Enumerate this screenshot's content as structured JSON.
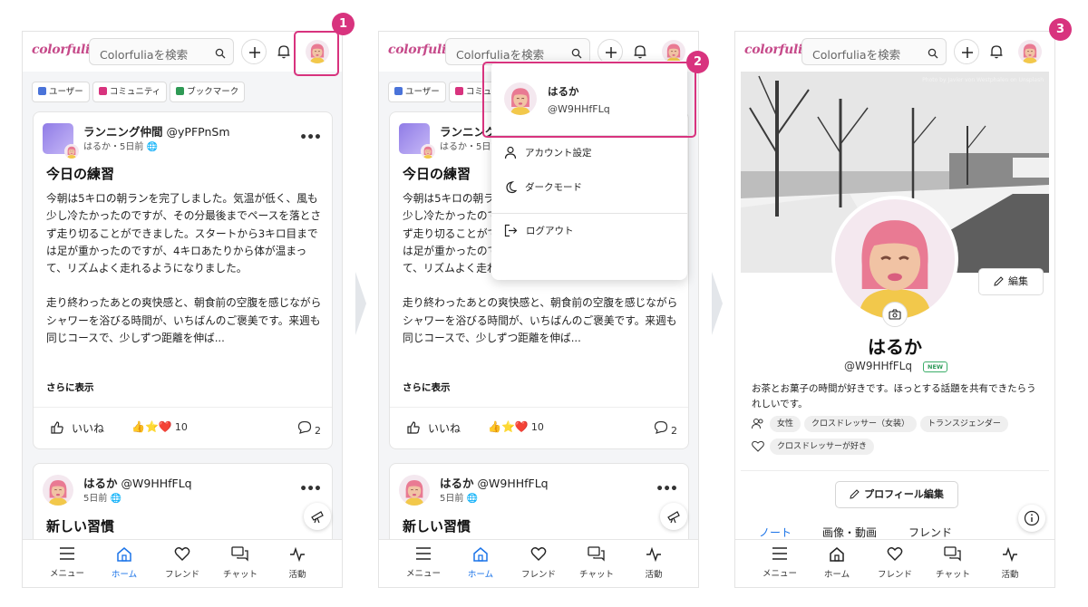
{
  "app": {
    "logo": "colorfulia",
    "search_placeholder": "Colorfuliaを検索"
  },
  "chips": {
    "users": "ユーザー",
    "communities": "コミュニティ",
    "bookmarks": "ブックマーク"
  },
  "post": {
    "community": "ランニング仲間",
    "handle": "@yPFPnSm",
    "meta": "はるか・5日前",
    "title": "今日の練習",
    "paragraph1": "今朝は5キロの朝ランを完了しました。気温が低く、風も少し冷たかったのですが、その分最後までペースを落とさず走り切ることができました。スタートから3キロ目までは足が重かったのですが、4キロあたりから体が温まって、リズムよく走れるようになりました。",
    "paragraph2": "走り終わったあとの爽快感と、朝食前の空腹を感じながらシャワーを浴びる時間が、いちばんのご褒美です。来週も同じコースで、少しずつ距離を伸ば...",
    "more": "さらに表示",
    "like_label": "いいね",
    "reactions": "👍⭐❤️",
    "reaction_count": "10",
    "comment_count": "2"
  },
  "note": {
    "author": "はるか",
    "handle": "@W9HHfFLq",
    "meta": "5日前",
    "title": "新しい習慣"
  },
  "nav": {
    "menu": "メニュー",
    "home": "ホーム",
    "friends": "フレンド",
    "chat": "チャット",
    "activity": "活動"
  },
  "dropdown": {
    "name": "はるか",
    "handle": "@W9HHfFLq",
    "account": "アカウント設定",
    "dark": "ダークモード",
    "logout": "ログアウト"
  },
  "profile": {
    "photo_credit": "Photo by Javier von Westphalen on Unsplash",
    "edit": "編集",
    "name": "はるか",
    "handle": "@W9HHfFLq",
    "new_badge": "NEW",
    "bio": "お茶とお菓子の時間が好きです。ほっとする話題を共有できたらうれしいです。",
    "tags": [
      "女性",
      "クロスドレッサー（女装）",
      "トランスジェンダー"
    ],
    "likes": [
      "クロスドレッサーが好き"
    ],
    "edit_profile": "プロフィール編集",
    "tabs": [
      "ノート",
      "画像・動画",
      "フレンド"
    ]
  },
  "steps": [
    "1",
    "2",
    "3"
  ],
  "colors": {
    "highlight": "#d8337e",
    "accent": "#1a73e8",
    "hair": "#e97a93",
    "skin": "#f1c3a4",
    "shirt": "#f2c84b"
  }
}
